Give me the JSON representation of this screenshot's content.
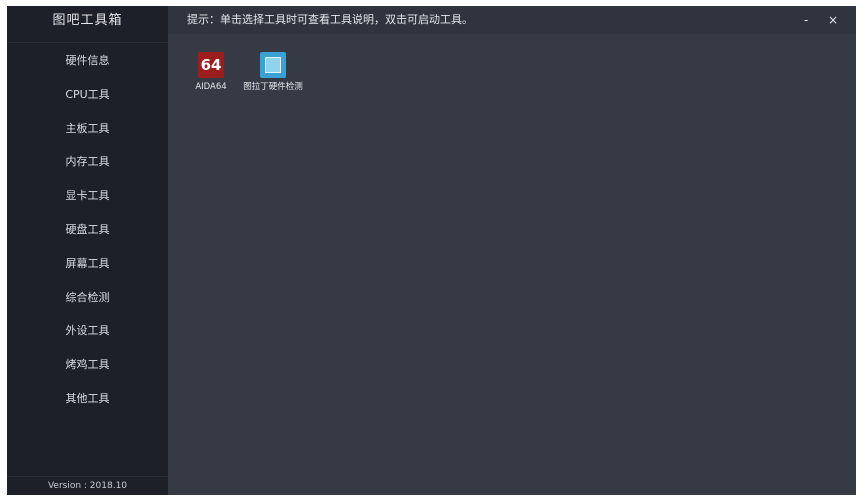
{
  "app": {
    "title": "图吧工具箱",
    "version": "Version : 2018.10"
  },
  "sidebar": {
    "items": [
      {
        "label": "硬件信息"
      },
      {
        "label": "CPU工具"
      },
      {
        "label": "主板工具"
      },
      {
        "label": "内存工具"
      },
      {
        "label": "显卡工具"
      },
      {
        "label": "硬盘工具"
      },
      {
        "label": "屏幕工具"
      },
      {
        "label": "综合检测"
      },
      {
        "label": "外设工具"
      },
      {
        "label": "烤鸡工具"
      },
      {
        "label": "其他工具"
      }
    ]
  },
  "topbar": {
    "tip": "提示：单击选择工具时可查看工具说明，双击可启动工具。",
    "minimize": "-",
    "close": "×"
  },
  "tools": [
    {
      "name": "AIDA64",
      "icon_text": "64",
      "icon": "aida64-icon",
      "color": "#9b1d1d"
    },
    {
      "name": "图拉丁硬件检测",
      "icon": "tulading-icon",
      "color": "#3aa1d2"
    }
  ]
}
